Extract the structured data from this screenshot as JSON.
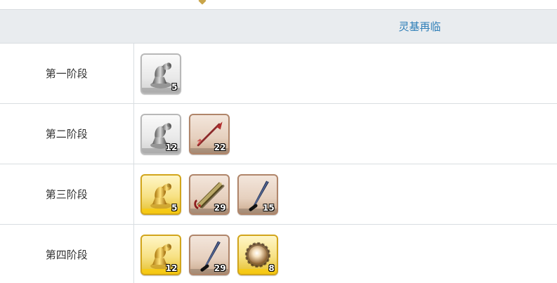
{
  "header": {
    "col1": "",
    "col2": "灵基再临"
  },
  "rows": [
    {
      "stage": "第一阶段",
      "items": [
        {
          "icon": "silver-piece-icon",
          "count": "5",
          "frame": "silver"
        }
      ]
    },
    {
      "stage": "第二阶段",
      "items": [
        {
          "icon": "silver-piece-icon",
          "count": "12",
          "frame": "silver"
        },
        {
          "icon": "feather-dart-icon",
          "count": "22",
          "frame": "bronze"
        }
      ]
    },
    {
      "stage": "第三阶段",
      "items": [
        {
          "icon": "gold-piece-icon",
          "count": "5",
          "frame": "gold"
        },
        {
          "icon": "bamboo-tube-icon",
          "count": "29",
          "frame": "bronze"
        },
        {
          "icon": "dark-blade-icon",
          "count": "15",
          "frame": "bronze"
        }
      ]
    },
    {
      "stage": "第四阶段",
      "items": [
        {
          "icon": "gold-piece-icon",
          "count": "12",
          "frame": "gold"
        },
        {
          "icon": "dark-blade-icon",
          "count": "29",
          "frame": "bronze"
        },
        {
          "icon": "orb-ring-icon",
          "count": "8",
          "frame": "gold"
        }
      ]
    }
  ]
}
